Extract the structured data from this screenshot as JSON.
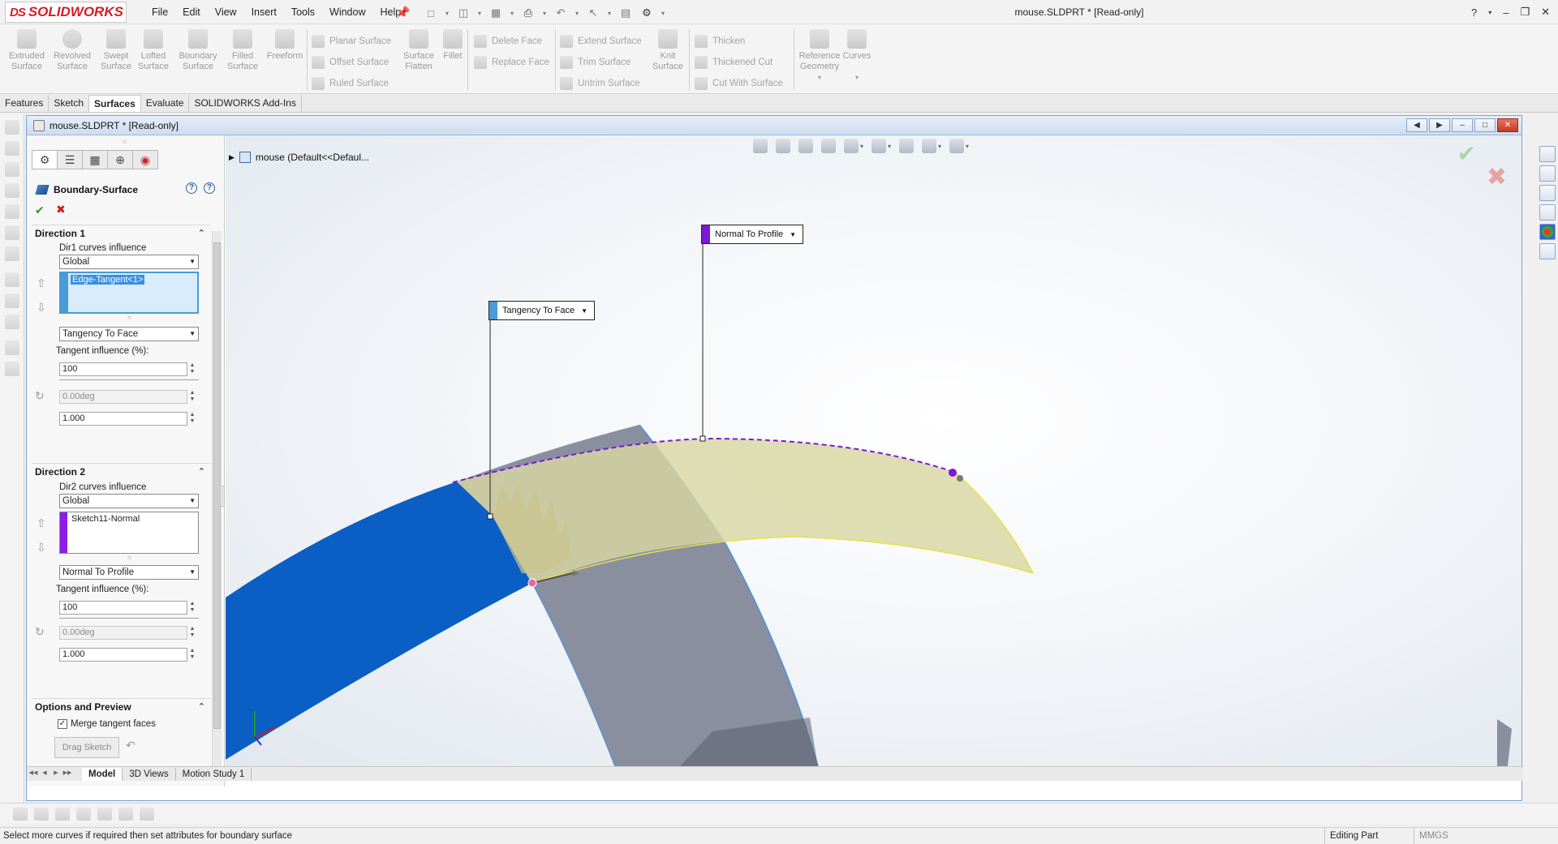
{
  "app": {
    "logo_text": "SOLIDWORKS",
    "menu": [
      "File",
      "Edit",
      "View",
      "Insert",
      "Tools",
      "Window",
      "Help"
    ],
    "document_title": "mouse.SLDPRT * [Read-only]"
  },
  "command_manager": {
    "big_buttons": [
      {
        "label": "Extruded Surface"
      },
      {
        "label": "Revolved Surface"
      },
      {
        "label": "Swept Surface"
      },
      {
        "label": "Lofted Surface"
      },
      {
        "label": "Boundary Surface"
      },
      {
        "label": "Filled Surface"
      },
      {
        "label": "Freeform"
      }
    ],
    "group1": [
      "Planar Surface",
      "Offset Surface",
      "Ruled Surface"
    ],
    "surface_flatten": "Surface Flatten",
    "fillet": "Fillet",
    "group2": [
      "Delete Face",
      "Replace Face"
    ],
    "group3": [
      "Extend Surface",
      "Trim Surface",
      "Untrim Surface"
    ],
    "knit_surface": "Knit Surface",
    "group4": [
      "Thicken",
      "Thickened Cut",
      "Cut With Surface"
    ],
    "reference_geometry": "Reference Geometry",
    "curves": "Curves"
  },
  "tabs": [
    "Features",
    "Sketch",
    "Surfaces",
    "Evaluate",
    "SOLIDWORKS Add-Ins"
  ],
  "active_tab": "Surfaces",
  "doc_window": {
    "title": "mouse.SLDPRT * [Read-only]"
  },
  "property_manager": {
    "title": "Boundary-Surface",
    "direction1": {
      "header": "Direction 1",
      "influence_label": "Dir1 curves influence",
      "influence_value": "Global",
      "curve_item": "Edge-Tangent<1>",
      "condition": "Tangency To Face",
      "tangent_label": "Tangent influence (%):",
      "tangent_value": "100",
      "angle_value": "0.00deg",
      "scale_value": "1.000",
      "curve_color": "#4a9bd9"
    },
    "direction2": {
      "header": "Direction 2",
      "influence_label": "Dir2 curves influence",
      "influence_value": "Global",
      "curve_item": "Sketch11-Normal",
      "condition": "Normal To Profile",
      "tangent_label": "Tangent influence (%):",
      "tangent_value": "100",
      "angle_value": "0.00deg",
      "scale_value": "1.000",
      "curve_color": "#8a1ee6"
    },
    "options": {
      "header": "Options and Preview",
      "merge_label": "Merge tangent faces",
      "merge_checked": true,
      "drag_sketch": "Drag Sketch"
    }
  },
  "viewport": {
    "tree_label": "mouse  (Default<<Defaul...",
    "callout_dir1": "Tangency To Face",
    "callout_dir2": "Normal To Profile",
    "colors": {
      "face_blue": "#0b5fc4",
      "face_gray": "#8a8fa0",
      "preview_yellow": "#d8d7a2",
      "profile_purple": "#7d17d9"
    }
  },
  "doc_tabs": [
    "Model",
    "3D Views",
    "Motion Study 1"
  ],
  "active_doc_tab": "Model",
  "status": {
    "message": "Select more curves if required then set attributes for boundary surface",
    "mode": "Editing Part",
    "units": "MMGS"
  }
}
